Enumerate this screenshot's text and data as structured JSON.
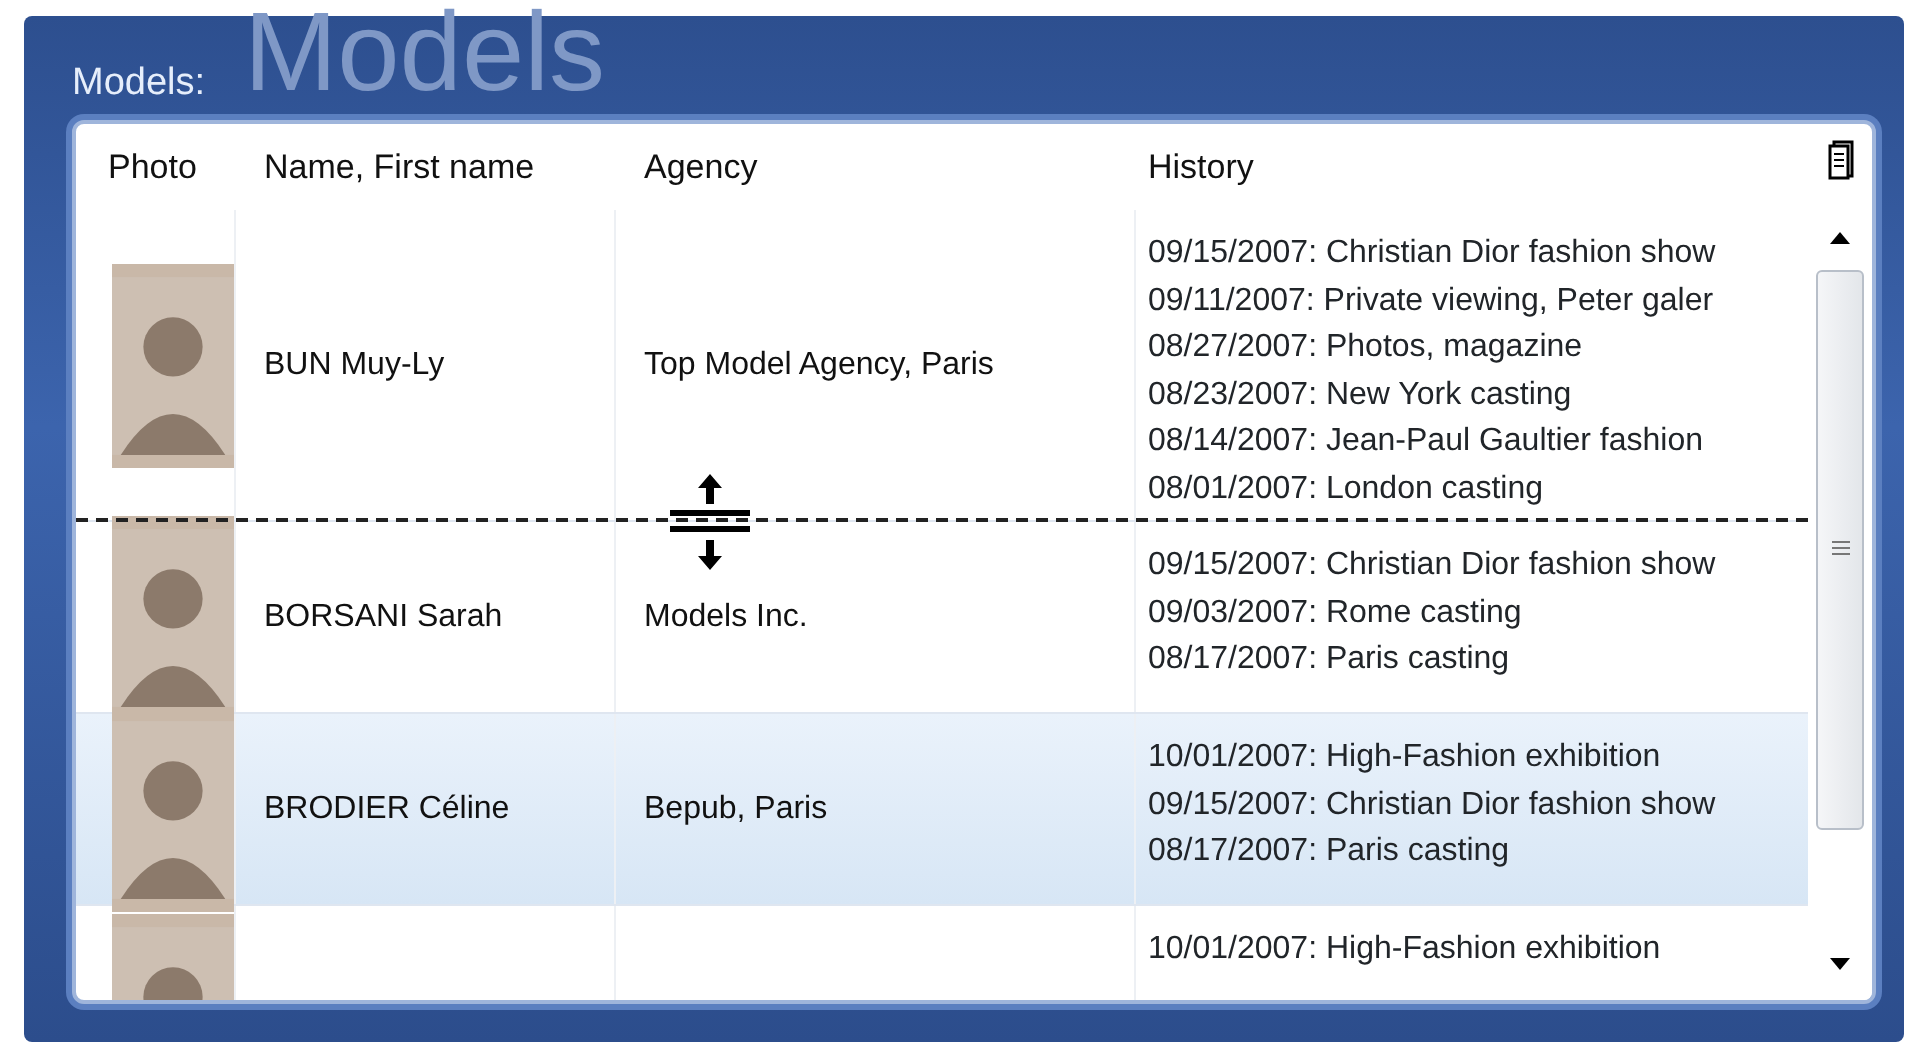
{
  "group": {
    "label": "Models:",
    "backdrop_title": "Models"
  },
  "table": {
    "columns": [
      "Photo",
      "Name, First name",
      "Agency",
      "History"
    ],
    "rows": [
      {
        "name": "BUN Muy-Ly",
        "agency": "Top Model Agency, Paris",
        "selected": false,
        "history": [
          "09/15/2007: Christian Dior fashion show",
          "09/11/2007: Private viewing, Peter galer",
          "08/27/2007: Photos, magazine",
          "08/23/2007: New York casting",
          "08/14/2007: Jean-Paul Gaultier fashion",
          "08/01/2007: London casting"
        ]
      },
      {
        "name": "BORSANI Sarah",
        "agency": "Models Inc.",
        "selected": false,
        "history": [
          "09/15/2007: Christian Dior fashion show",
          "09/03/2007: Rome casting",
          "08/17/2007: Paris casting"
        ]
      },
      {
        "name": "BRODIER Céline",
        "agency": "Bepub, Paris",
        "selected": true,
        "history": [
          "10/01/2007: High-Fashion exhibition",
          "09/15/2007: Christian Dior fashion show",
          "08/17/2007: Paris casting"
        ]
      },
      {
        "selected": false,
        "history": [
          "10/01/2007: High-Fashion exhibition"
        ]
      }
    ]
  }
}
